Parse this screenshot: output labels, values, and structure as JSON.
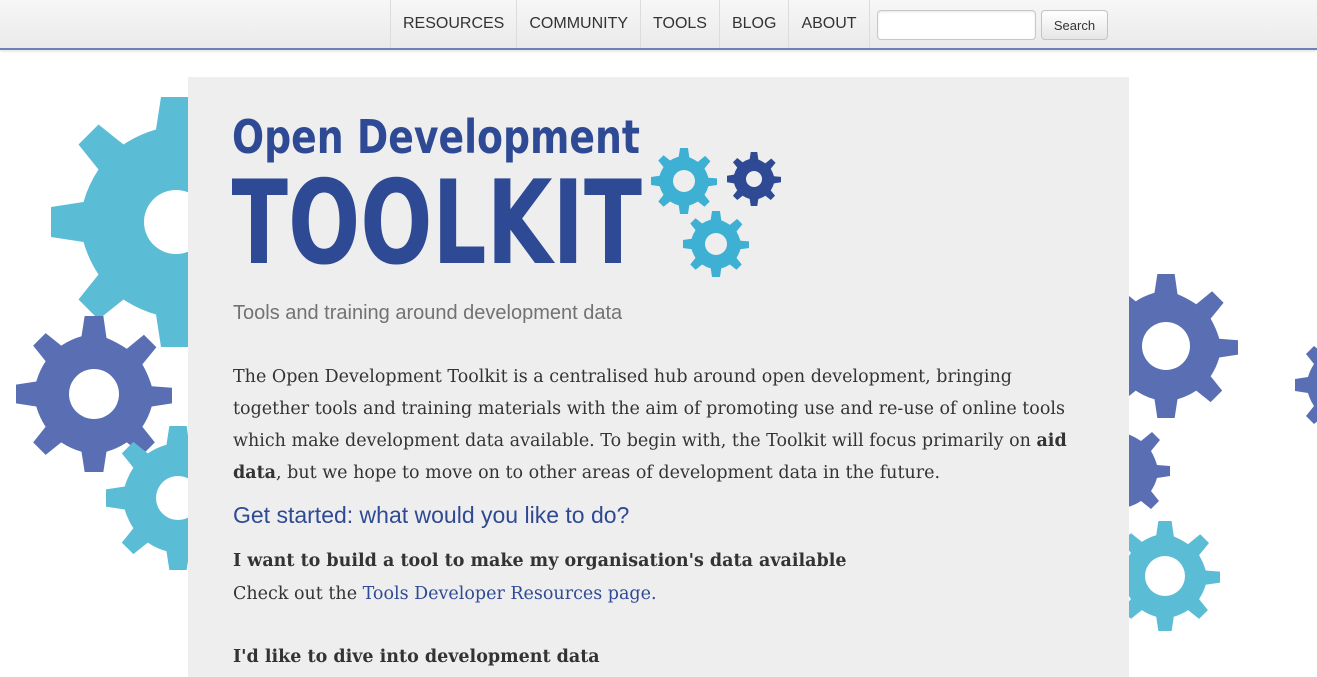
{
  "nav": {
    "items": [
      "RESOURCES",
      "COMMUNITY",
      "TOOLS",
      "BLOG",
      "ABOUT"
    ],
    "search_value": "",
    "search_button": "Search"
  },
  "logo": {
    "line1": "Open Development",
    "line2": "TOOLKIT"
  },
  "main": {
    "tagline": "Tools and training around development data",
    "intro_part1": "The Open Development Toolkit is a centralised hub around open development, bringing together tools and training materials with the aim of promoting use and re-use of online tools which make development data available. To begin with, the Toolkit will focus primarily on ",
    "intro_bold": "aid data",
    "intro_part2": ", but we hope to move on to other areas of development data in the future.",
    "get_started": "Get started: what would you like to do?",
    "q1": "I want to build a tool to make my organisation's data available",
    "a1_prefix": "Check out the ",
    "a1_link": "Tools Developer Resources page.",
    "q2": "I'd like to dive into development data"
  },
  "colors": {
    "light_blue": "#5bbcd6",
    "mid_blue": "#4a6db3",
    "dark_blue": "#2f4a94",
    "panel_bg": "#eeeeee"
  }
}
